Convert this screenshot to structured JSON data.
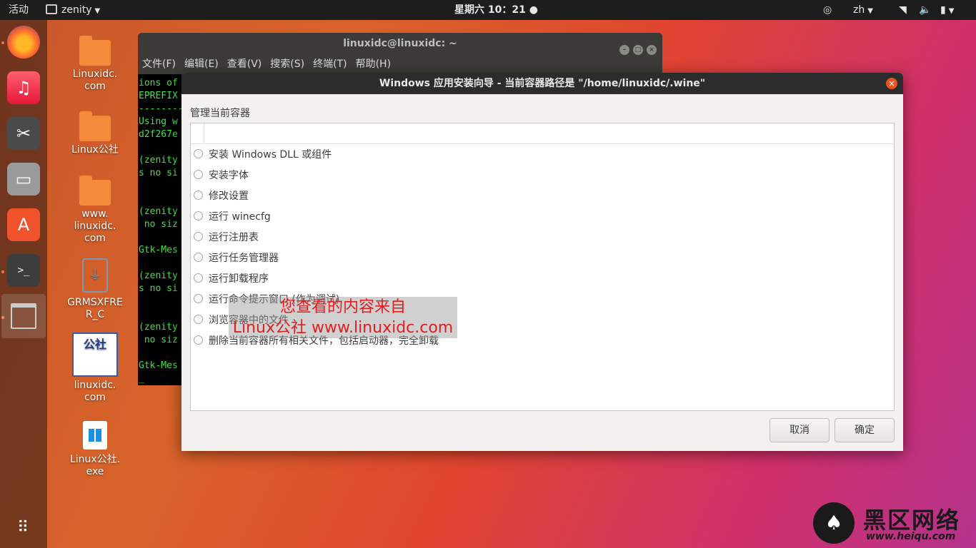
{
  "topbar": {
    "activities": "活动",
    "app_name": "zenity",
    "clock": "星期六 10：21",
    "lang": "zh"
  },
  "desktop": {
    "icons": [
      {
        "label": "Linuxidc.\ncom"
      },
      {
        "label": "Linux公社"
      },
      {
        "label": "www.\nlinuxidc.\ncom"
      },
      {
        "label": "GRMSXFRE\nR_C"
      },
      {
        "label": "linuxidc.\ncom"
      },
      {
        "label": "Linux公社.\nexe"
      }
    ],
    "logo_thumb_text": "公社"
  },
  "terminal": {
    "title": "linuxidc@linuxidc: ~",
    "menu": [
      "文件(F)",
      "编辑(E)",
      "查看(V)",
      "搜索(S)",
      "终端(T)",
      "帮助(H)"
    ],
    "lines": [
      "ions of",
      "EPREFIX",
      "--------",
      "Using w",
      "d2f267e",
      "",
      "(zenity",
      "s no si",
      "",
      "",
      "(zenity",
      " no siz",
      "",
      "Gtk-Mes",
      "",
      "(zenity",
      "s no si",
      "",
      "",
      "(zenity",
      " no siz",
      "",
      "Gtk-Mes",
      "_"
    ]
  },
  "dialog": {
    "title": "Windows 应用安装向导 - 当前容器路径是 \"/home/linuxidc/.wine\"",
    "section_label": "管理当前容器",
    "options": [
      "安装 Windows DLL 或组件",
      "安装字体",
      "修改设置",
      "运行 winecfg",
      "运行注册表",
      "运行任务管理器",
      "运行卸载程序",
      "运行命令提示窗口 (作为调试)",
      "浏览容器中的文件",
      "删除当前容器所有相关文件，包括启动器，完全卸载"
    ],
    "cancel_label": "取消",
    "ok_label": "确定"
  },
  "watermark": {
    "line1": "您查看的内容来自",
    "line2": "Linux公社 www.linuxidc.com"
  },
  "corner_logo": {
    "name": "黑区网络",
    "url": "www.heiqu.com"
  }
}
